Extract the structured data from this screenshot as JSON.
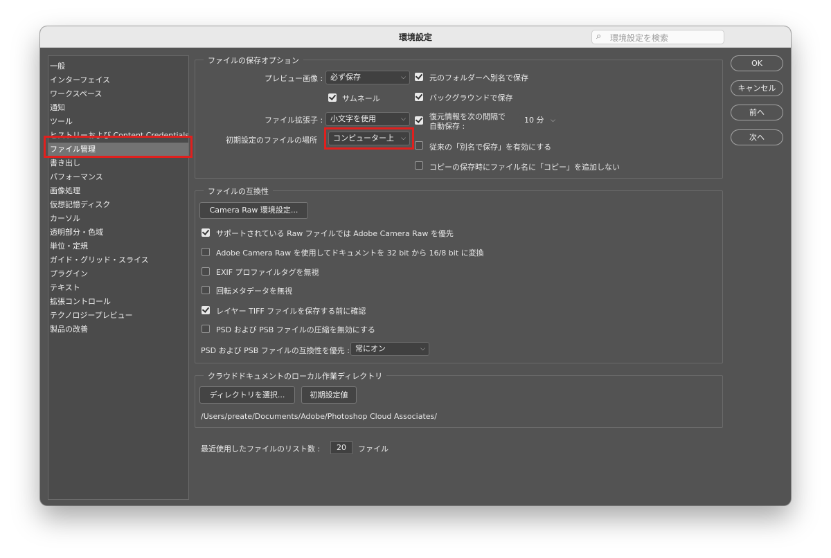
{
  "window": {
    "title": "環境設定",
    "search_placeholder": "環境設定を検索"
  },
  "sidebar": {
    "items": [
      "一般",
      "インターフェイス",
      "ワークスペース",
      "通知",
      "ツール",
      "ヒストリーおよび Content Credentials",
      "ファイル管理",
      "書き出し",
      "パフォーマンス",
      "画像処理",
      "仮想記憶ディスク",
      "カーソル",
      "透明部分・色域",
      "単位・定規",
      "ガイド・グリッド・スライス",
      "プラグイン",
      "テキスト",
      "拡張コントロール",
      "テクノロジープレビュー",
      "製品の改善"
    ],
    "selected_index": 6
  },
  "buttons": {
    "ok": "OK",
    "cancel": "キャンセル",
    "prev": "前へ",
    "next": "次へ"
  },
  "save_options": {
    "legend": "ファイルの保存オプション",
    "preview_label": "プレビュー画像 :",
    "preview_value": "必ず保存",
    "thumbnail_label": "サムネール",
    "thumbnail_checked": true,
    "ext_label": "ファイル拡張子 :",
    "ext_value": "小文字を使用",
    "location_label": "初期設定のファイルの場所",
    "location_value": "コンピューター上",
    "save_as_original": "元のフォルダーへ別名で保存",
    "save_as_original_checked": true,
    "background_save": "バックグラウンドで保存",
    "background_save_checked": true,
    "autosave_line1": "復元情報を次の間隔で",
    "autosave_line2": "自動保存 :",
    "autosave_checked": true,
    "autosave_value": "10 分",
    "legacy_save_as": "従来の「別名で保存」を有効にする",
    "legacy_save_as_checked": false,
    "no_copy_suffix": "コピーの保存時にファイル名に「コピー」を追加しない",
    "no_copy_suffix_checked": false
  },
  "compat": {
    "legend": "ファイルの互換性",
    "camera_raw_button": "Camera Raw 環境設定...",
    "options": [
      {
        "label": "サポートされている Raw ファイルでは Adobe Camera Raw を優先",
        "checked": true
      },
      {
        "label": "Adobe Camera Raw を使用してドキュメントを 32 bit から 16/8 bit に変換",
        "checked": false
      },
      {
        "label": "EXIF プロファイルタグを無視",
        "checked": false
      },
      {
        "label": "回転メタデータを無視",
        "checked": false
      },
      {
        "label": "レイヤー TIFF ファイルを保存する前に確認",
        "checked": true
      },
      {
        "label": "PSD および PSB ファイルの圧縮を無効にする",
        "checked": false
      }
    ],
    "psd_compat_label": "PSD および PSB ファイルの互換性を優先 :",
    "psd_compat_value": "常にオン"
  },
  "cloud": {
    "legend": "クラウドドキュメントのローカル作業ディレクトリ",
    "choose_button": "ディレクトリを選択...",
    "default_button": "初期設定値",
    "path": "/Users/preate/Documents/Adobe/Photoshop Cloud Associates/"
  },
  "recent": {
    "label": "最近使用したファイルのリスト数 :",
    "value": "20",
    "unit": "ファイル"
  },
  "colors": {
    "highlight": "#e0201e",
    "panel": "#535353",
    "selected_item": "#737373"
  }
}
